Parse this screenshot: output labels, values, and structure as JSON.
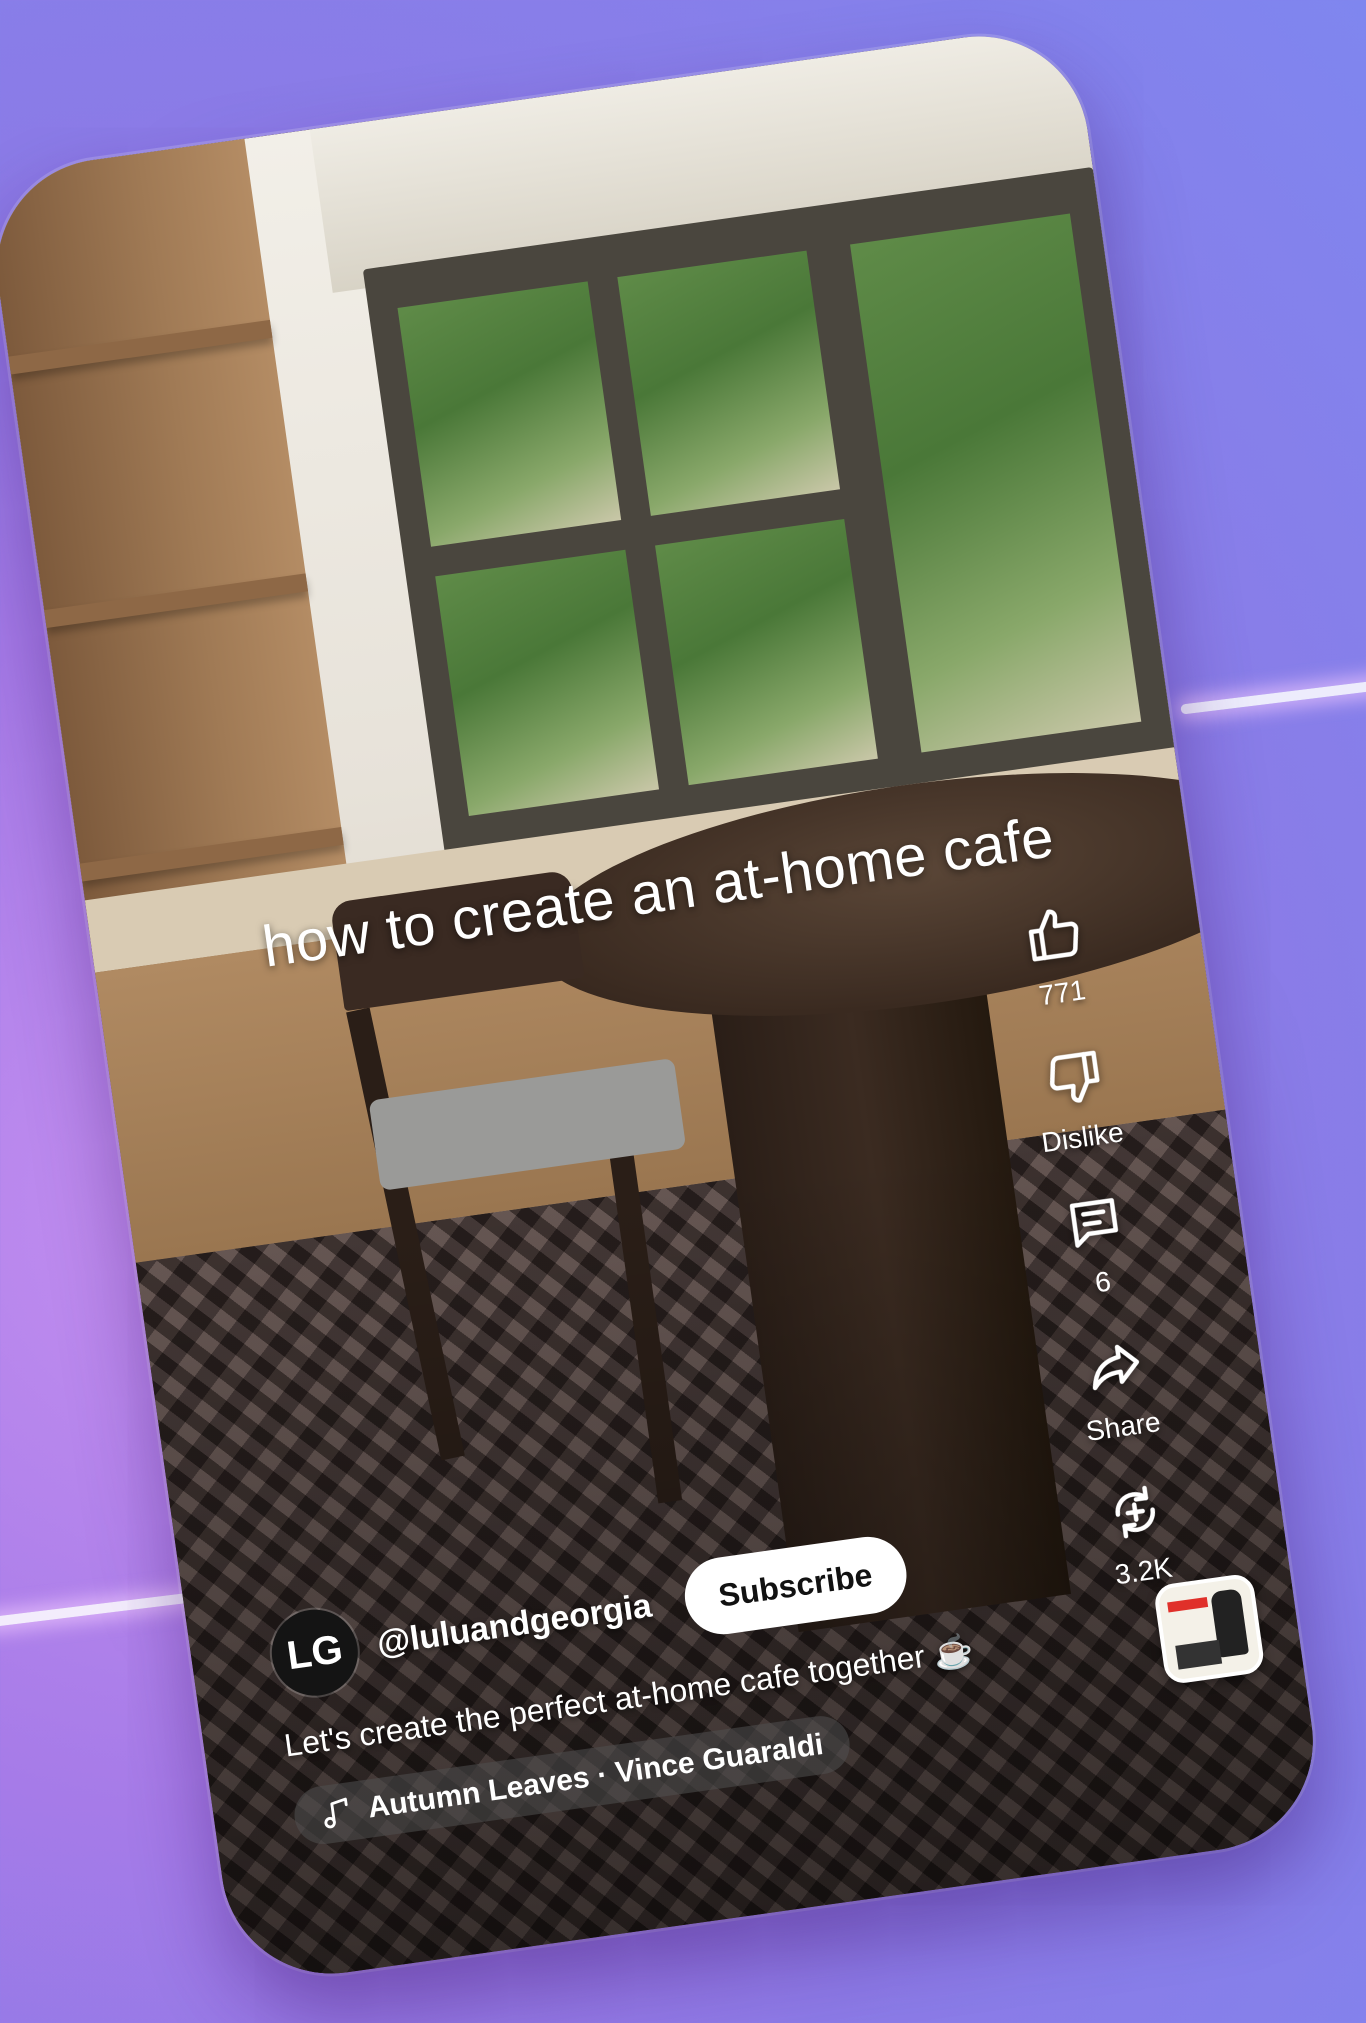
{
  "video": {
    "overlay_caption": "how to create an at-home cafe"
  },
  "actions": {
    "like": {
      "icon": "thumbs-up-icon",
      "label": "771"
    },
    "dislike": {
      "icon": "thumbs-down-icon",
      "label": "Dislike"
    },
    "comments": {
      "icon": "comment-icon",
      "label": "6"
    },
    "share": {
      "icon": "share-icon",
      "label": "Share"
    },
    "remix": {
      "icon": "remix-icon",
      "label": "3.2K"
    }
  },
  "channel": {
    "avatar_text": "LG",
    "handle": "@luluandgeorgia",
    "subscribe_label": "Subscribe"
  },
  "description": "Let's create the perfect at-home cafe together ☕",
  "music": {
    "icon": "music-note-icon",
    "label": "Autumn Leaves · Vince Guaraldi"
  },
  "colors": {
    "background_start": "#c48ff0",
    "background_end": "#7f86ef",
    "glow": "#ffffff"
  }
}
